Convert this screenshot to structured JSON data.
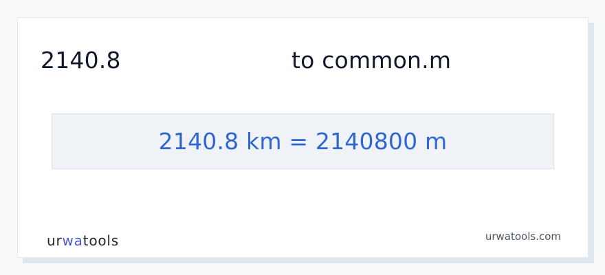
{
  "conversion": {
    "input_value": "2140.8",
    "target_label": "to common.m",
    "result": "2140.8 km = 2140800 m"
  },
  "footer": {
    "logo_prefix": "ur",
    "logo_accent": "wa",
    "logo_suffix": "tools",
    "site": "urwatools.com"
  },
  "colors": {
    "result_text": "#2f66d0",
    "logo_accent": "#4a57d6",
    "result_background": "#eff3f8"
  }
}
